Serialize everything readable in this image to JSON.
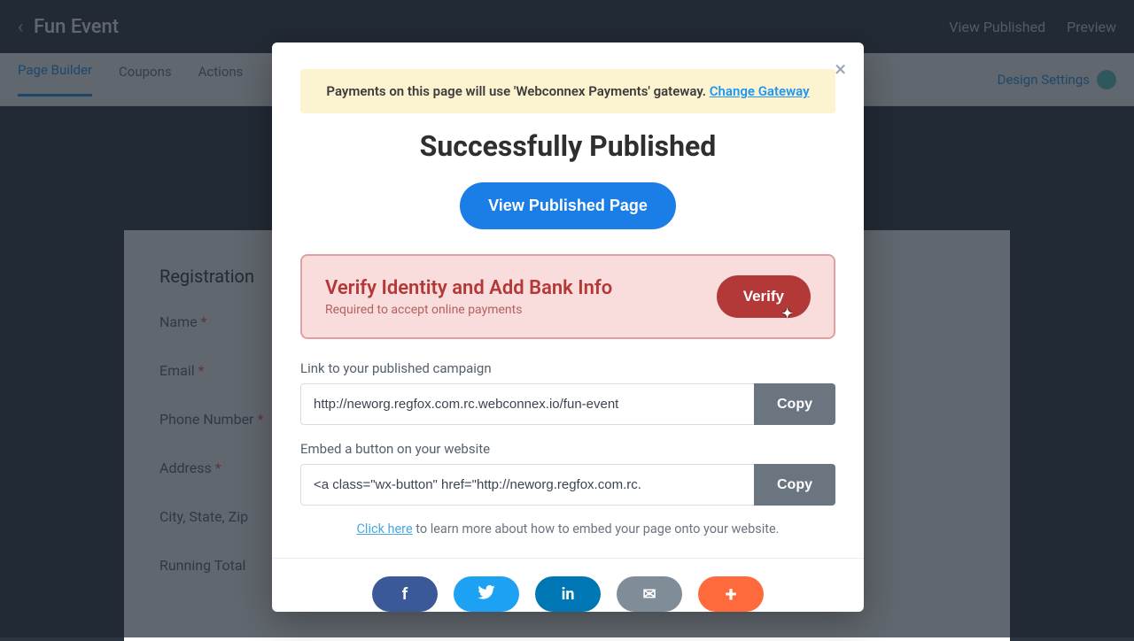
{
  "topbar": {
    "event_title": "Fun Event",
    "view_published": "View Published",
    "preview": "Preview"
  },
  "subbar": {
    "tab_page_builder": "Page Builder",
    "tab_coupons": "Coupons",
    "tab_actions": "Actions",
    "design_settings": "Design Settings"
  },
  "bg_form": {
    "section_title": "Registration",
    "name": "Name",
    "email": "Email",
    "phone": "Phone Number",
    "address": "Address",
    "city": "City, State, Zip",
    "running": "Running Total"
  },
  "modal": {
    "banner_prefix": "Payments on this page will use 'Webconnex Payments' gateway. ",
    "banner_link": "Change Gateway",
    "title": "Successfully Published",
    "view_button": "View Published Page",
    "verify": {
      "title": "Verify Identity and Add Bank Info",
      "subtitle": "Required to accept online payments",
      "button": "Verify"
    },
    "link_label": "Link to your published campaign",
    "link_value": "http://neworg.regfox.com.rc.webconnex.io/fun-event",
    "embed_label": "Embed a button on your website",
    "embed_value": "<a class=\"wx-button\" href=\"http://neworg.regfox.com.rc.",
    "copy": "Copy",
    "learn_link": "Click here",
    "learn_rest": " to learn more about how to embed your page onto your website."
  },
  "share": {
    "facebook": "f",
    "twitter": "🐦",
    "linkedin": "in",
    "email": "✉",
    "plus": "+"
  }
}
